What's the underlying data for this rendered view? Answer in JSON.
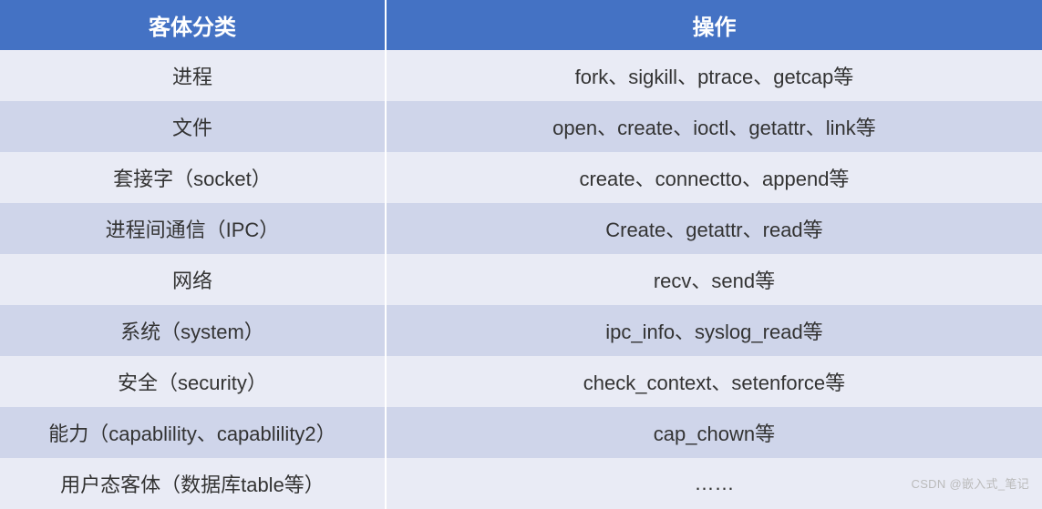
{
  "table": {
    "headers": [
      "客体分类",
      "操作"
    ],
    "rows": [
      {
        "category": "进程",
        "operation": "fork、sigkill、ptrace、getcap等"
      },
      {
        "category": "文件",
        "operation": "open、create、ioctl、getattr、link等"
      },
      {
        "category": "套接字（socket）",
        "operation": "create、connectto、append等"
      },
      {
        "category": "进程间通信（IPC）",
        "operation": "Create、getattr、read等"
      },
      {
        "category": "网络",
        "operation": "recv、send等"
      },
      {
        "category": "系统（system）",
        "operation": "ipc_info、syslog_read等"
      },
      {
        "category": "安全（security）",
        "operation": "check_context、setenforce等"
      },
      {
        "category": "能力（capablility、capablility2）",
        "operation": "cap_chown等"
      },
      {
        "category": "用户态客体（数据库table等）",
        "operation": "……"
      }
    ]
  },
  "watermark": "CSDN @嵌入式_笔记"
}
